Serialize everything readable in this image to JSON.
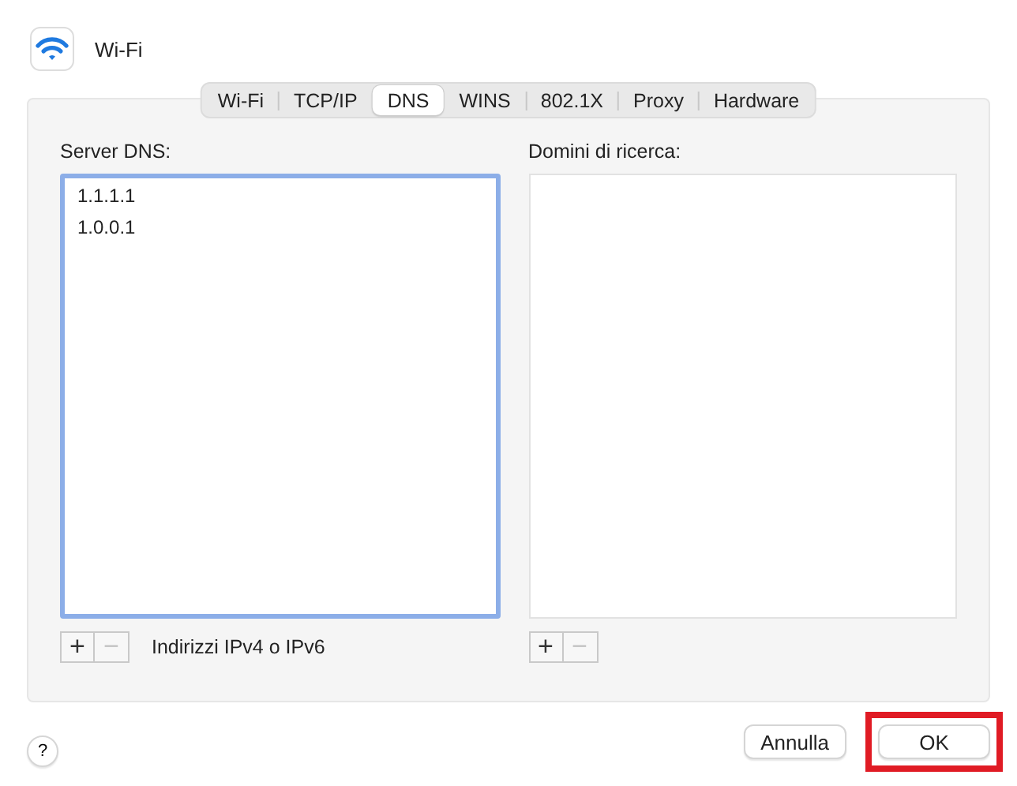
{
  "window": {
    "title": "Wi-Fi"
  },
  "tabs": [
    {
      "label": "Wi-Fi",
      "selected": false
    },
    {
      "label": "TCP/IP",
      "selected": false
    },
    {
      "label": "DNS",
      "selected": true
    },
    {
      "label": "WINS",
      "selected": false
    },
    {
      "label": "802.1X",
      "selected": false
    },
    {
      "label": "Proxy",
      "selected": false
    },
    {
      "label": "Hardware",
      "selected": false
    }
  ],
  "lists": [
    {
      "label": "Server DNS:",
      "focused": true,
      "items": [
        "1.1.1.1",
        "1.0.0.1"
      ],
      "add": {
        "label": "+",
        "disabled": false
      },
      "remove": {
        "label": "−",
        "disabled": true
      },
      "hint": "Indirizzi IPv4 o IPv6"
    },
    {
      "label": "Domini di ricerca:",
      "focused": false,
      "add": {
        "label": "+",
        "disabled": false
      },
      "remove": {
        "label": "−",
        "disabled": true
      }
    }
  ],
  "help": {
    "label": "?"
  },
  "buttons": [
    {
      "label": "Annulla",
      "highlighted": false
    },
    {
      "label": "OK",
      "highlighted": true
    }
  ]
}
